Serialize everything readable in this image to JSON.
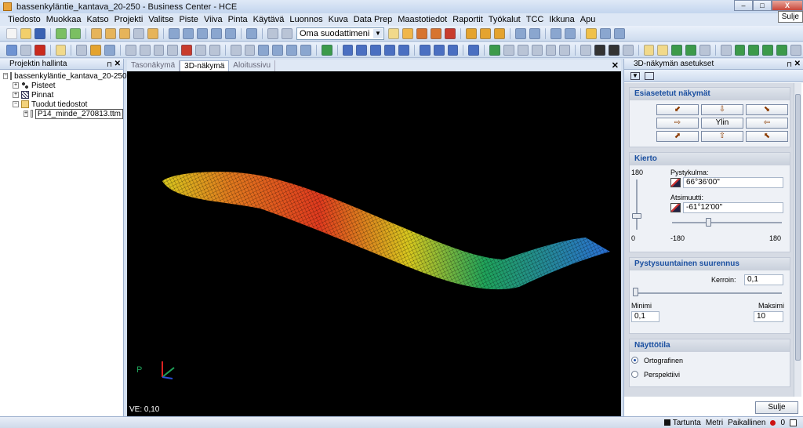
{
  "window": {
    "title": "bassenkyläntie_kantava_20-250 - Business Center - HCE",
    "min_label": "–",
    "max_label": "□",
    "close_label": "X",
    "tooltip": "Sulje"
  },
  "menu": [
    "Tiedosto",
    "Muokkaa",
    "Katso",
    "Projekti",
    "Valitse",
    "Piste",
    "Viiva",
    "Pinta",
    "Käytävä",
    "Luonnos",
    "Kuva",
    "Data Prep",
    "Maastotiedot",
    "Raportit",
    "Työkalut",
    "TCC",
    "Ikkuna",
    "Apu"
  ],
  "toolbar": {
    "filter_value": "Oma suodattimeni",
    "filter_arrow": "▼"
  },
  "left_panel": {
    "title": "Projektin hallinta",
    "pin": "⊓",
    "close": "✕",
    "tree": {
      "project": "bassenkyläntie_kantava_20-250",
      "points": "Pisteet",
      "surfaces": "Pinnat",
      "imported": "Tuodut tiedostot",
      "file": "P14_minde_270813.ttm",
      "expand_minus": "−",
      "expand_plus": "+"
    }
  },
  "view": {
    "tabs": [
      "Tasonäkymä",
      "3D-näkymä",
      "Aloitussivu"
    ],
    "active_tab": "3D-näkymä",
    "close": "✕",
    "ve_label": "VE: 0,10",
    "axis_label": "P",
    "colors": {
      "background": "#000000",
      "ramp": [
        "#2a6fd6",
        "#1fa35a",
        "#d8c81e",
        "#e03a1e"
      ]
    }
  },
  "right_panel": {
    "title": "3D-näkymän asetukset",
    "pin": "⊓",
    "close": "✕",
    "preset": {
      "title": "Esiasetetut näkymät",
      "center_label": "Ylin",
      "buttons": [
        "⬋",
        "⇩",
        "⬊",
        "⇨",
        "Ylin",
        "⇦",
        "⬈",
        "⇧",
        "⬉"
      ]
    },
    "rotation": {
      "title": "Kierto",
      "top_value": "180",
      "bottom_value": "0",
      "vertical_angle_label": "Pystykulma:",
      "vertical_angle_value": "66°36'00\"",
      "azimuth_label": "Atsimuutti:",
      "azimuth_value": "-61°12'00\"",
      "min_label": "-180",
      "max_label": "180",
      "vertical_level": 0.0,
      "azimuth_level": -0.34
    },
    "exaggeration": {
      "title": "Pystysuuntainen suurennus",
      "factor_label": "Kerroin:",
      "factor_value": "0,1",
      "min_label": "Minimi",
      "max_label": "Maksimi",
      "min_value": "0,1",
      "max_value": "10",
      "level": 0.0
    },
    "display": {
      "title": "Näyttötila",
      "options": [
        "Ortografinen",
        "Perspektiivi"
      ],
      "selected": "Ortografinen"
    },
    "close_button": "Sulje"
  },
  "status": {
    "snap": "Tartunta",
    "units": "Metri",
    "coords": "Paikallinen",
    "count": "0"
  }
}
